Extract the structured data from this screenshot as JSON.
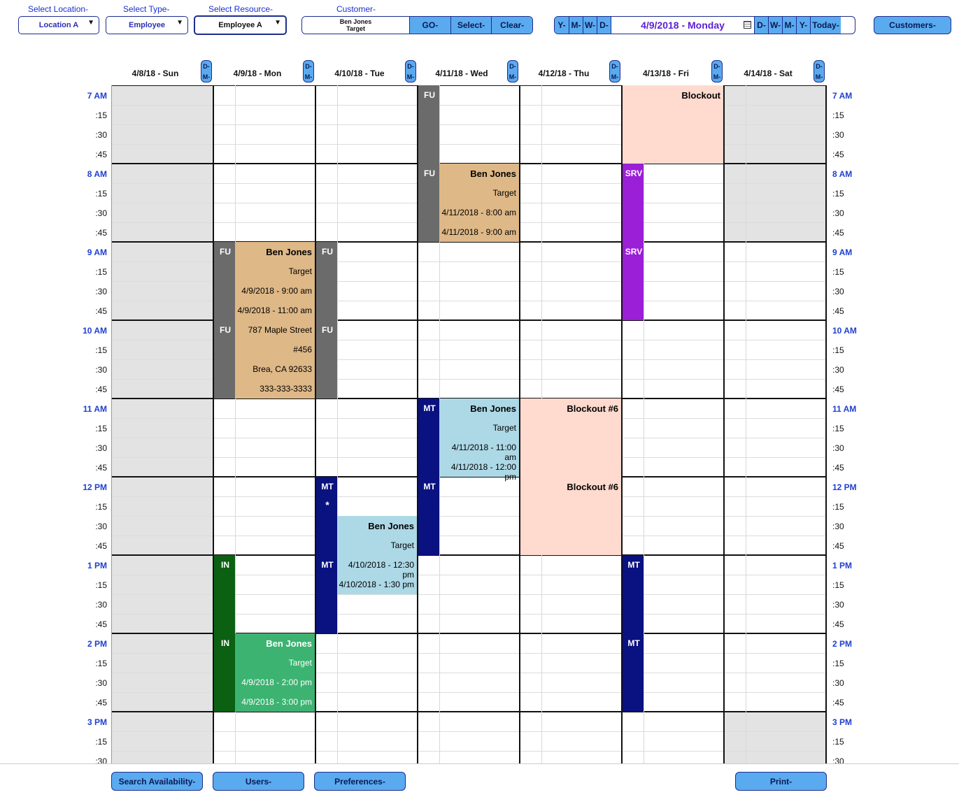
{
  "toolbar": {
    "location": {
      "label": "Select Location-",
      "value": "Location A"
    },
    "type": {
      "label": "Select Type-",
      "value": "Employee"
    },
    "resource": {
      "label": "Select Resource-",
      "value": "Employee A"
    },
    "customer": {
      "label": "Customer-",
      "name": "Ben Jones",
      "company": "Target"
    },
    "go": "GO-",
    "select": "Select-",
    "clear": "Clear-",
    "nav_left": [
      "Y-",
      "M-",
      "W-",
      "D-"
    ],
    "date_display": "4/9/2018 - Monday",
    "calendar_icon": "calendar-icon",
    "nav_right": [
      "D-",
      "W-",
      "M-",
      "Y-"
    ],
    "today": "Today-",
    "customers": "Customers-"
  },
  "day_button": {
    "top": "D-",
    "bottom": "M-"
  },
  "days": [
    "4/8/18 - Sun",
    "4/9/18 - Mon",
    "4/10/18 - Tue",
    "4/11/18 - Wed",
    "4/12/18 - Thu",
    "4/13/18 - Fri",
    "4/14/18 - Sat"
  ],
  "time_labels": [
    "7 AM",
    ":15",
    ":30",
    ":45",
    "8 AM",
    ":15",
    ":30",
    ":45",
    "9 AM",
    ":15",
    ":30",
    ":45",
    "10 AM",
    ":15",
    ":30",
    ":45",
    "11 AM",
    ":15",
    ":30",
    ":45",
    "12 PM",
    ":15",
    ":30",
    ":45",
    "1 PM",
    ":15",
    ":30",
    ":45",
    "2 PM",
    ":15",
    ":30",
    ":45",
    "3 PM",
    ":15",
    ":30"
  ],
  "tags": {
    "fu": "FU",
    "srv": "SRV",
    "mt": "MT",
    "in": "IN",
    "star": "*"
  },
  "events": {
    "wed_followup": {
      "name": "Ben Jones",
      "company": "Target",
      "start": "4/11/2018 - 8:00 am",
      "end": "4/11/2018 - 9:00 am"
    },
    "fri_blockout": {
      "name": "Blockout"
    },
    "mon_followup": {
      "name": "Ben Jones",
      "company": "Target",
      "start": "4/9/2018 - 9:00 am",
      "end": "4/9/2018 - 11:00 am",
      "street": "787 Maple Street",
      "unit": "#456",
      "city": "Brea, CA 92633",
      "phone": "333-333-3333"
    },
    "wed_meeting": {
      "name": "Ben Jones",
      "company": "Target",
      "start": "4/11/2018 - 11:00 am",
      "end": "4/11/2018 - 12:00 pm"
    },
    "thu_blockout": {
      "name": "Blockout #6"
    },
    "tue_meeting": {
      "name": "Ben Jones",
      "company": "Target",
      "start": "4/10/2018 - 12:30 pm",
      "end": "4/10/2018 - 1:30 pm"
    },
    "mon_interview": {
      "name": "Ben Jones",
      "company": "Target",
      "start": "4/9/2018 - 2:00 pm",
      "end": "4/9/2018 - 3:00 pm"
    }
  },
  "colors": {
    "fu": "#6b6b6b",
    "followup_bg": "#deb887",
    "srv": "#9a1fd6",
    "mt": "#0a1180",
    "meeting_bg": "#add8e6",
    "interview_tag": "#0b6012",
    "interview_bg": "#3cb371",
    "blockout": "#ffdace",
    "closed": "#e3e3e3",
    "nav_button": "#5aaaf0",
    "time_label": "#2040d0"
  },
  "footer": {
    "search": "Search Availability-",
    "users": "Users-",
    "preferences": "Preferences-",
    "print": "Print-"
  }
}
